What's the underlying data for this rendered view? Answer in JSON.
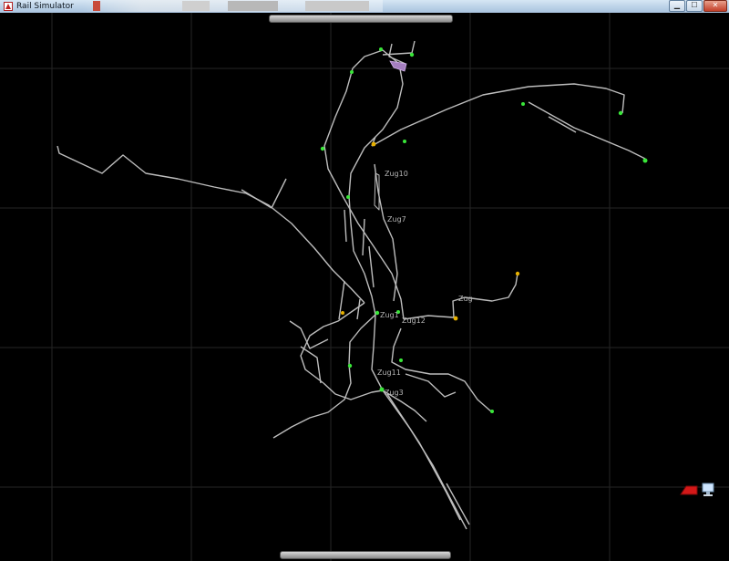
{
  "window": {
    "title": "Rail Simulator"
  },
  "title_buttons": {
    "minimize": "▁",
    "maximize": "☐",
    "close": "✕"
  },
  "map": {
    "background": "#000000",
    "grid_color": "#2a2a2a",
    "track_color": "#bdbdbd",
    "signal_color": "#39e639",
    "warning_color": "#e6b000",
    "train_labels": [
      "Zug10",
      "Zug7",
      "Zug1",
      "Zug12",
      "Zug11",
      "Zug3",
      "Zug"
    ]
  },
  "tools": {
    "eraser": "eraser-icon",
    "monitor": "monitor-icon"
  }
}
